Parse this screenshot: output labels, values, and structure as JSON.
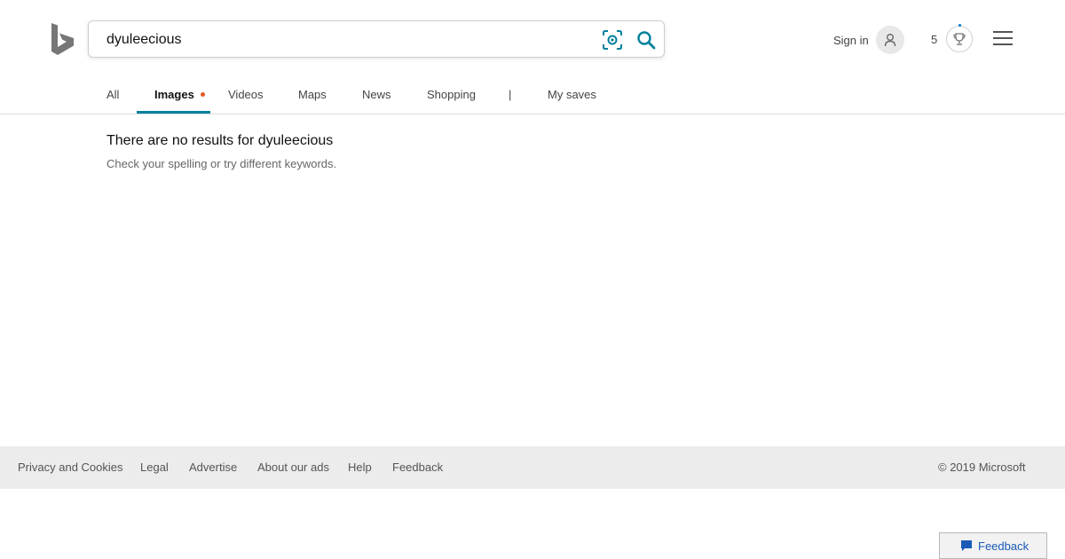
{
  "search": {
    "query": "dyuleecious",
    "visual_search_icon": "camera-scan-icon",
    "search_icon": "magnifier-icon"
  },
  "header": {
    "sign_in_label": "Sign in",
    "avatar_icon": "user-icon",
    "rewards_count": "5",
    "rewards_icon": "trophy-icon",
    "menu_icon": "hamburger-icon"
  },
  "tabs": [
    {
      "label": "All"
    },
    {
      "label": "Images",
      "active": true
    },
    {
      "label": "Videos"
    },
    {
      "label": "Maps"
    },
    {
      "label": "News"
    },
    {
      "label": "Shopping"
    },
    {
      "label": "|"
    },
    {
      "label": "My saves"
    }
  ],
  "results": {
    "title": "There are no results for dyuleecious",
    "subtitle": "Check your spelling or try different keywords."
  },
  "footer": {
    "links": [
      "Privacy and Cookies",
      "Legal",
      "Advertise",
      "About our ads",
      "Help",
      "Feedback"
    ],
    "copyright": "© 2019 Microsoft"
  },
  "feedback_button": {
    "label": "Feedback",
    "icon": "speech-bubble-icon"
  },
  "colors": {
    "accent": "#00809d",
    "active_dot": "#e8571e",
    "feedback_text": "#1a5bb8"
  }
}
